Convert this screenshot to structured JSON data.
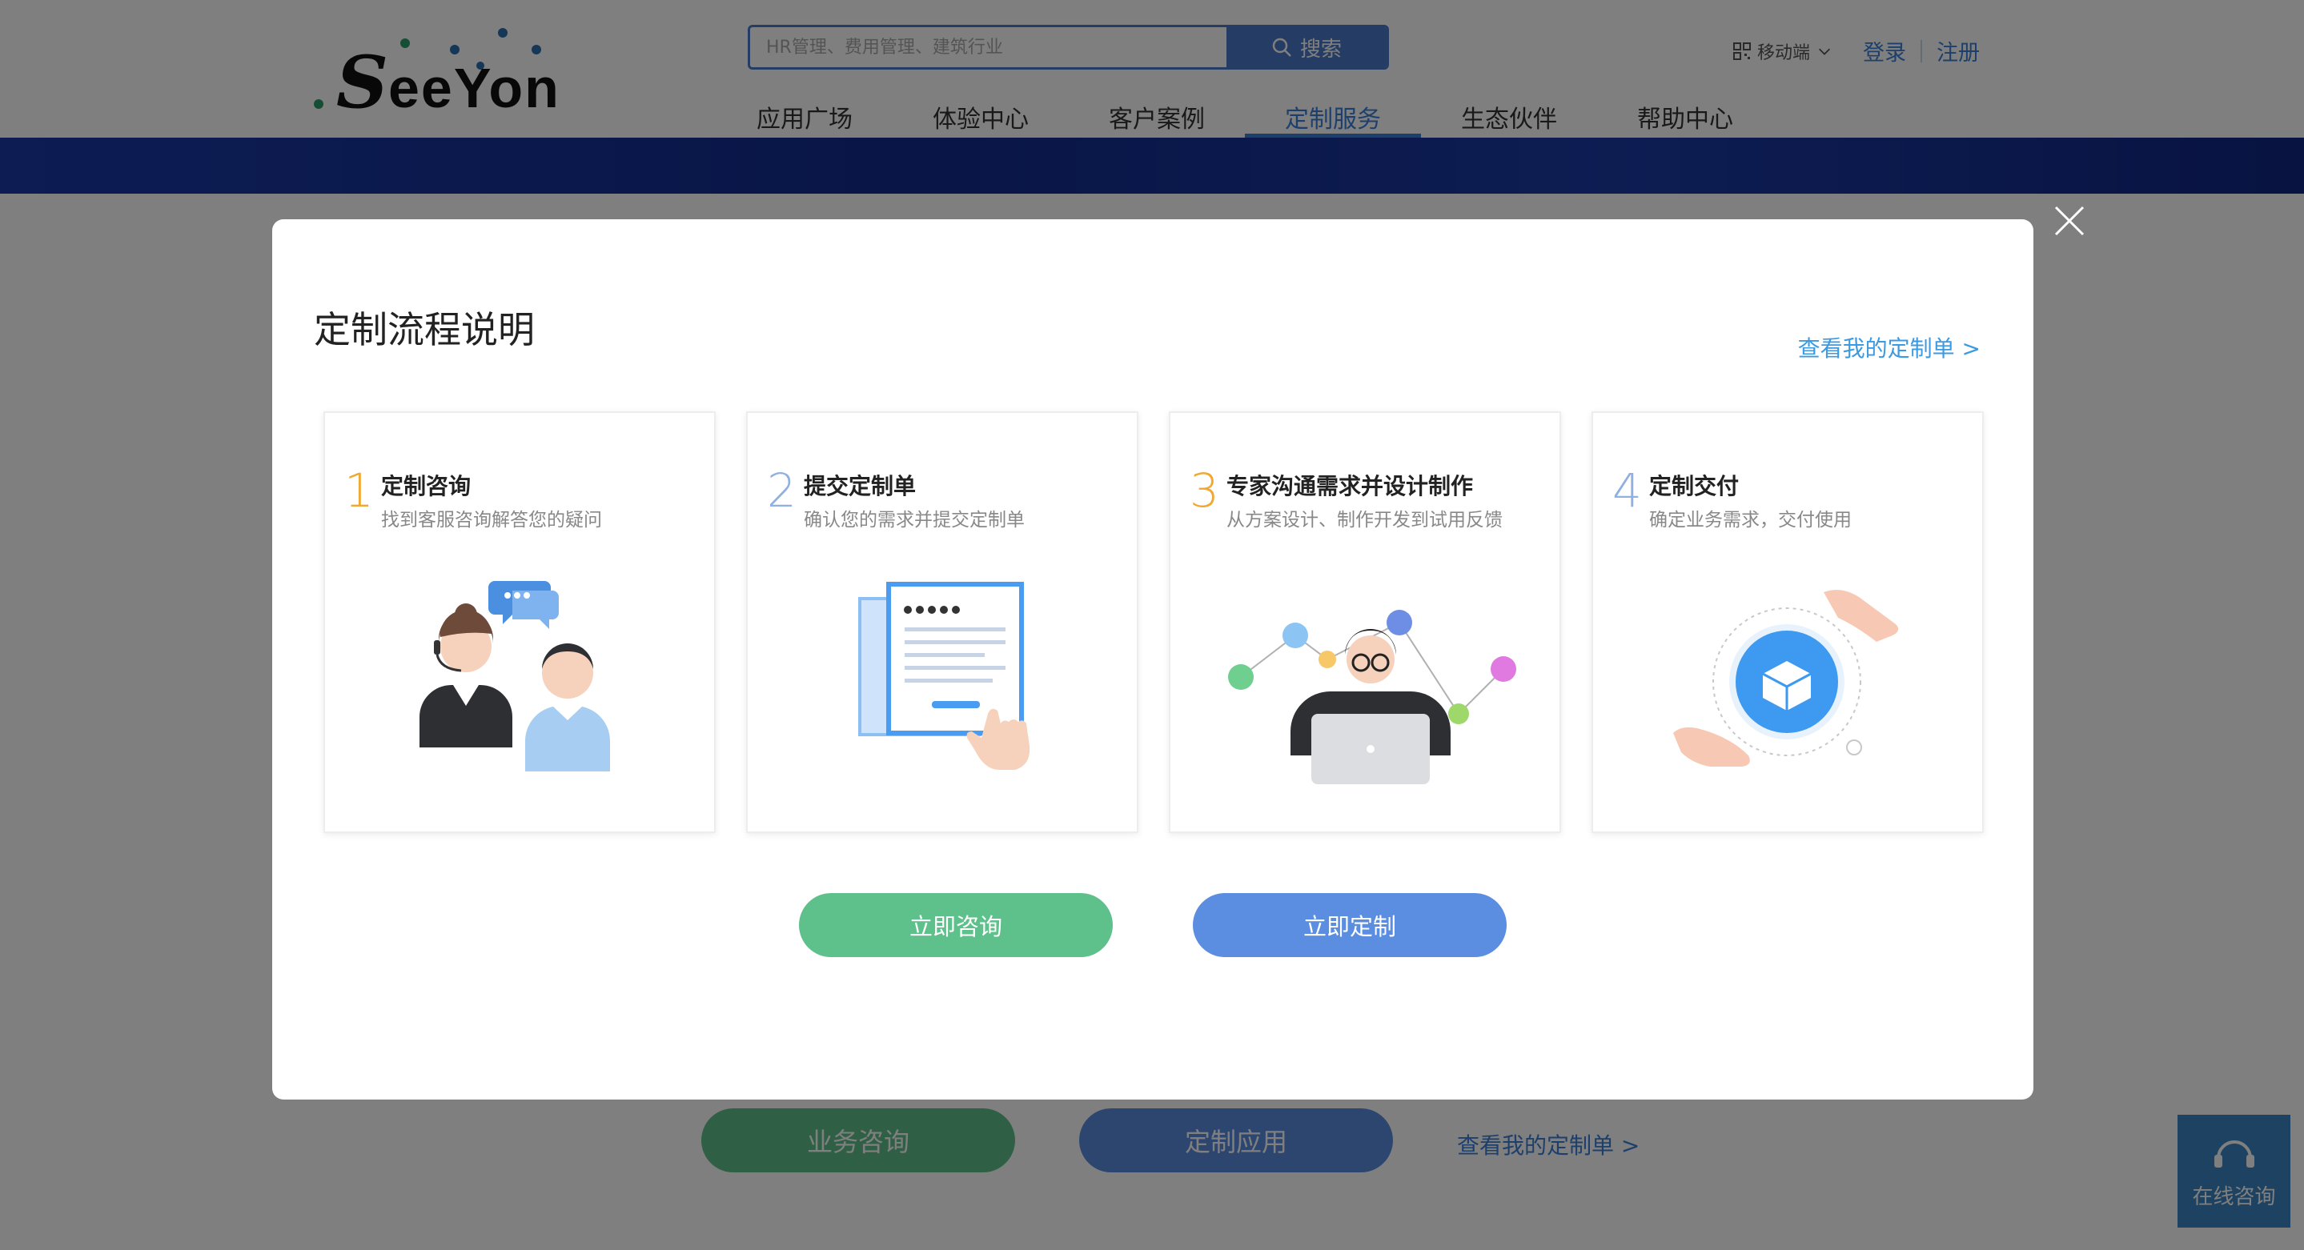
{
  "header": {
    "logo_text": "Seeyon",
    "search": {
      "placeholder": "HR管理、费用管理、建筑行业",
      "button_label": "搜索"
    },
    "mobile_label": "移动端",
    "login_label": "登录",
    "register_label": "注册",
    "nav": [
      {
        "label": "应用广场"
      },
      {
        "label": "体验中心"
      },
      {
        "label": "客户案例"
      },
      {
        "label": "定制服务"
      },
      {
        "label": "生态伙伴"
      },
      {
        "label": "帮助中心"
      }
    ]
  },
  "page": {
    "consult_button": "业务咨询",
    "custom_app_button": "定制应用",
    "my_orders_link": "查看我的定制单 >",
    "chat_widget_label": "在线咨询"
  },
  "modal": {
    "title": "定制流程说明",
    "my_orders_link": "查看我的定制单 >",
    "steps": [
      {
        "num": "1",
        "title": "定制咨询",
        "desc": "找到客服咨询解答您的疑问"
      },
      {
        "num": "2",
        "title": "提交定制单",
        "desc": "确认您的需求并提交定制单"
      },
      {
        "num": "3",
        "title": "专家沟通需求并设计制作",
        "desc": "从方案设计、制作开发到试用反馈"
      },
      {
        "num": "4",
        "title": "定制交付",
        "desc": "确定业务需求，交付使用"
      }
    ],
    "consult_now_button": "立即咨询",
    "customize_now_button": "立即定制"
  },
  "colors": {
    "accent_blue": "#3b7fd9",
    "green_button": "#5ec08a",
    "blue_button": "#5b8de0",
    "step_num_orange": "#f0a830",
    "step_num_blue": "#8fb0e0"
  }
}
